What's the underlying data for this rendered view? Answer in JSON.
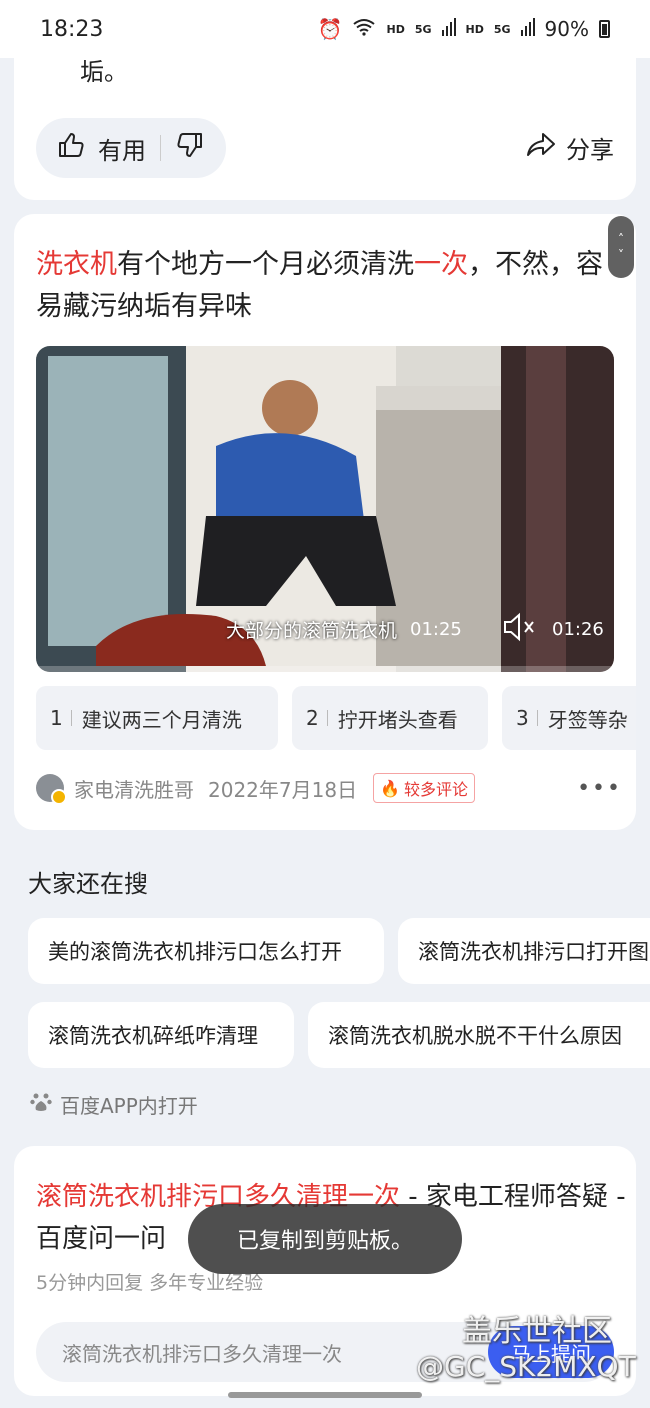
{
  "status_bar": {
    "time": "18:23",
    "hd1": "HD",
    "net1": "5G",
    "hd2": "HD",
    "net2": "5G",
    "battery": "90%"
  },
  "card1": {
    "text_tail": "垢。",
    "useful_label": "有用",
    "share_label": "分享"
  },
  "card2": {
    "title_hl1": "洗衣机",
    "title_mid": "有个地方一个月必须清洗",
    "title_hl2": "一次",
    "title_rest": "，不然，容易藏污纳垢有异味",
    "scroll_up": "˄",
    "scroll_down": "˅",
    "video": {
      "caption": "大部分的滚筒洗衣机",
      "current_time": "01:25",
      "duration": "01:26"
    },
    "chapters": [
      {
        "num": "1",
        "label": "建议两三个月清洗"
      },
      {
        "num": "2",
        "label": "拧开堵头查看"
      },
      {
        "num": "3",
        "label": "牙签等杂"
      }
    ],
    "author": "家电清洗胜哥",
    "date": "2022年7月18日",
    "badge": "较多评论",
    "more": "•••"
  },
  "related": {
    "title": "大家还在搜",
    "chips": [
      "美的滚筒洗衣机排污口怎么打开",
      "滚筒洗衣机排污口打开图",
      "滚筒洗衣机碎纸咋清理",
      "滚筒洗衣机脱水脱不干什么原因"
    ],
    "open_app": "百度APP内打开"
  },
  "card3": {
    "title_hl": "滚筒洗衣机排污口多久清理一次",
    "title_rest": " - 家电工程师答疑 - 百度问一问",
    "subtitle": "5分钟内回复 多年专业经验",
    "input_text": "滚筒洗衣机排污口多久清理一次",
    "ask_button": "马上提问"
  },
  "toast": "已复制到剪贴板。",
  "watermark": {
    "line1": "盖乐世社区",
    "line2": "@GC_SK2MXQT"
  },
  "colors": {
    "highlight": "#e53935",
    "accent": "#3b5ef0",
    "background": "#eef1f6"
  }
}
